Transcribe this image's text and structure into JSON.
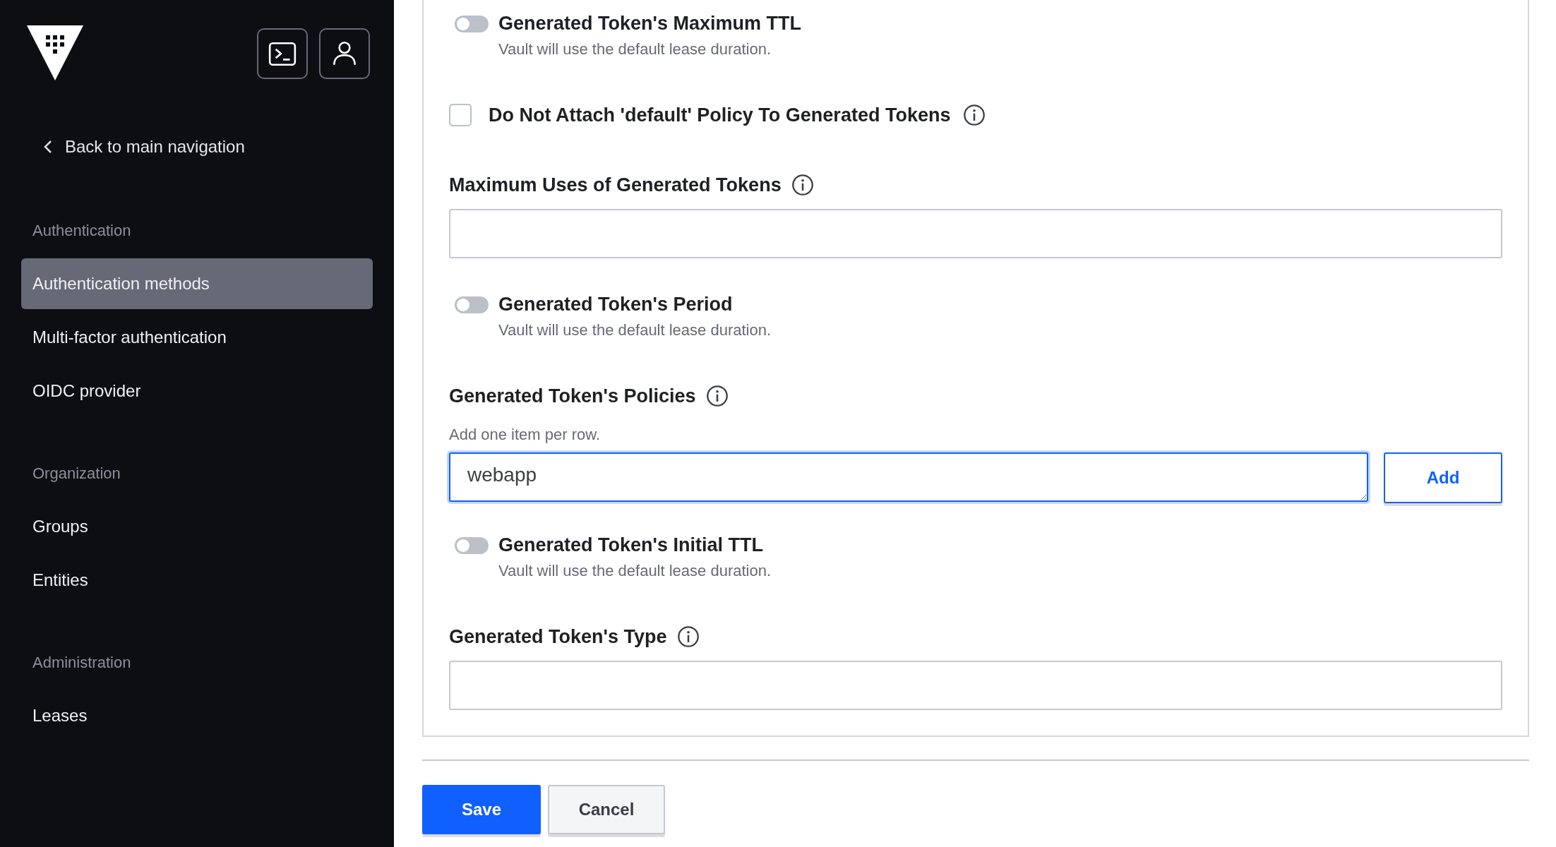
{
  "sidebar": {
    "back_link": "Back to main navigation",
    "sections": [
      {
        "heading": "Authentication",
        "items": [
          {
            "label": "Authentication methods",
            "selected": true
          },
          {
            "label": "Multi-factor authentication",
            "selected": false
          },
          {
            "label": "OIDC provider",
            "selected": false
          }
        ]
      },
      {
        "heading": "Organization",
        "items": [
          {
            "label": "Groups",
            "selected": false
          },
          {
            "label": "Entities",
            "selected": false
          }
        ]
      },
      {
        "heading": "Administration",
        "items": [
          {
            "label": "Leases",
            "selected": false
          }
        ]
      }
    ]
  },
  "form": {
    "fields": [
      {
        "kind": "toggle",
        "label": "Generated Token's Maximum TTL",
        "on": false,
        "help": "Vault will use the default lease duration."
      },
      {
        "kind": "checkbox",
        "label": "Do Not Attach 'default' Policy To Generated Tokens",
        "checked": false
      },
      {
        "kind": "input",
        "label": "Maximum Uses of Generated Tokens"
      },
      {
        "kind": "toggle",
        "label": "Generated Token's Period",
        "on": false,
        "help": "Vault will use the default lease duration."
      },
      {
        "kind": "list",
        "label": "Generated Token's Policies",
        "help": "Add one item per row.",
        "value": "webapp",
        "button": "Add"
      },
      {
        "kind": "toggle",
        "label": "Generated Token's Initial TTL",
        "on": false,
        "help": "Vault will use the default lease duration."
      },
      {
        "kind": "input",
        "label": "Generated Token's Type"
      }
    ]
  },
  "actions": {
    "save": "Save",
    "cancel": "Cancel"
  }
}
